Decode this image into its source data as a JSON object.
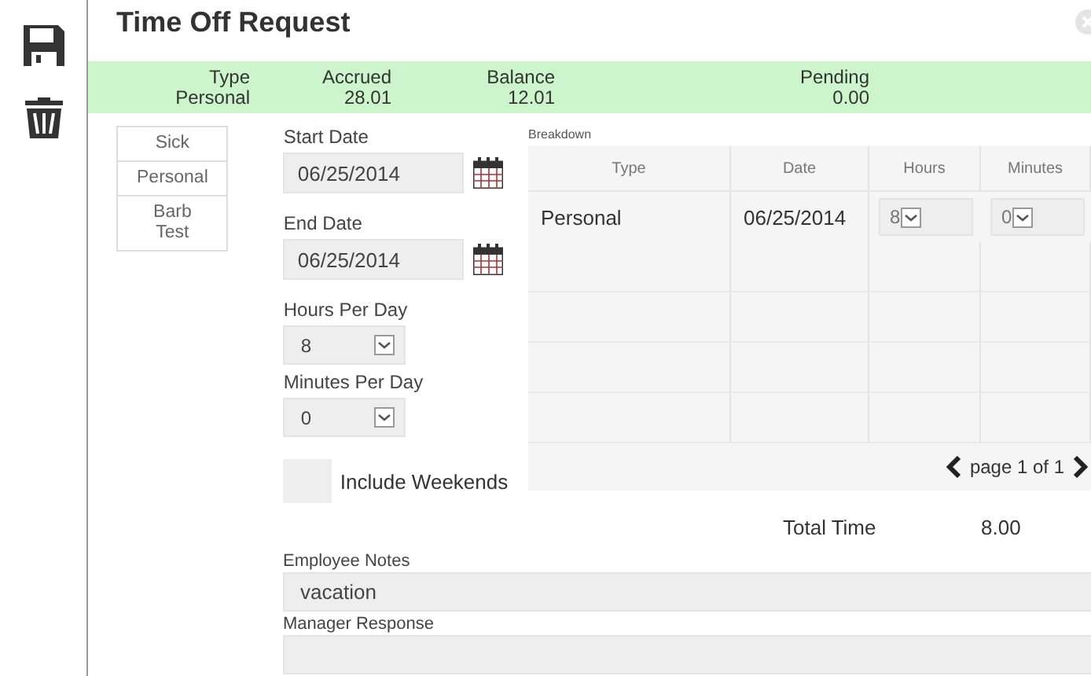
{
  "title": "Time Off Request",
  "summary": {
    "columns": [
      {
        "label": "Type",
        "value": "Personal"
      },
      {
        "label": "Accrued",
        "value": "28.01"
      },
      {
        "label": "Balance",
        "value": "12.01"
      },
      {
        "label": "Pending",
        "value": "0.00"
      }
    ]
  },
  "leave_types": [
    "Sick",
    "Personal",
    "Barb Test"
  ],
  "form": {
    "start_date": {
      "label": "Start Date",
      "value": "06/25/2014"
    },
    "end_date": {
      "label": "End Date",
      "value": "06/25/2014"
    },
    "hours_per_day": {
      "label": "Hours Per Day",
      "value": "8"
    },
    "minutes_per_day": {
      "label": "Minutes Per Day",
      "value": "0"
    },
    "include_weekends": {
      "label": "Include Weekends",
      "checked": false
    }
  },
  "breakdown": {
    "label": "Breakdown",
    "columns": [
      "Type",
      "Date",
      "Hours",
      "Minutes"
    ],
    "rows": [
      {
        "type": "Personal",
        "date": "06/25/2014",
        "hours": "8",
        "minutes": "0"
      }
    ],
    "pager": "page 1 of 1"
  },
  "total": {
    "label": "Total Time",
    "value": "8.00"
  },
  "employee_notes": {
    "label": "Employee Notes",
    "value": "vacation"
  },
  "manager_response": {
    "label": "Manager Response"
  }
}
